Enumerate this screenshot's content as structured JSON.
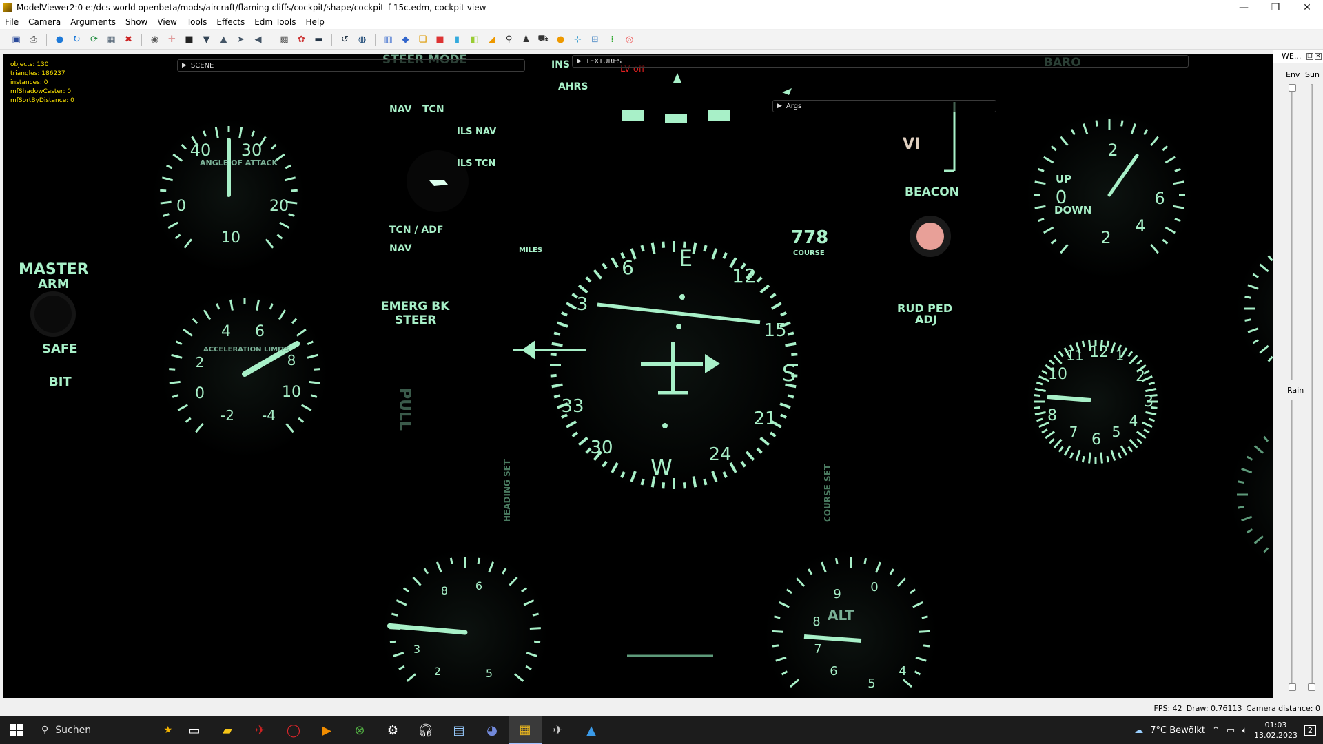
{
  "window": {
    "title": "ModelViewer2:0 e:/dcs world openbeta/mods/aircraft/flaming cliffs/cockpit/shape/cockpit_f-15c.edm, cockpit view",
    "minimize": "—",
    "maximize": "❐",
    "close": "✕"
  },
  "menu": [
    "File",
    "Camera",
    "Arguments",
    "Show",
    "View",
    "Tools",
    "Effects",
    "Edm Tools",
    "Help"
  ],
  "stats": {
    "objects": "objects: 130",
    "triangles": "triangles: 186237",
    "instances": "instances: 0",
    "shadow": "mfShadowCaster: 0",
    "sort": "mfSortByDistance: 0"
  },
  "panels": {
    "scene": "SCENE",
    "textures": "TEXTURES",
    "args": "Args"
  },
  "cockpit": {
    "steer_mode": "STEER MODE",
    "ins": "INS",
    "ahrs": "AHRS",
    "lvoff": "LV off",
    "baro": "BARO",
    "nav": "NAV",
    "tcn": "TCN",
    "ils_nav": "ILS NAV",
    "ils_tcn": "ILS TCN",
    "tcn_adf": "TCN / ADF",
    "nav2": "NAV",
    "master_arm": "MASTER",
    "arm": "ARM",
    "safe": "SAFE",
    "bit": "BIT",
    "emerg": "EMERG BK",
    "steer": "STEER",
    "pull": "PULL",
    "vi": "VI",
    "beacon": "BEACON",
    "rud_ped": "RUD PED",
    "adj": "ADJ",
    "aoa": "ANGLE OF ATTACK",
    "accel": "ACCELERATION LIMITS",
    "up": "UP",
    "down": "DOWN",
    "miles": "MILES",
    "course_digits": "778",
    "course": "COURSE",
    "heading_set": "HEADING SET",
    "course_set": "COURSE SET",
    "alt": "ALT"
  },
  "right_panel": {
    "title": "WE...",
    "env": "Env",
    "sun": "Sun",
    "rain": "Rain"
  },
  "status": {
    "fps": "FPS: 42",
    "draw": "Draw: 0.76113",
    "camera": "Camera distance: 0"
  },
  "taskbar": {
    "search": "Suchen",
    "weather": "7°C Bewölkt",
    "time": "01:03",
    "date": "13.02.2023",
    "notifications": "2"
  },
  "colors": {
    "glow": "#a8f0c8",
    "dim": "#5e9a7a",
    "beacon": "#e8a098",
    "stats": "#ffe600"
  }
}
